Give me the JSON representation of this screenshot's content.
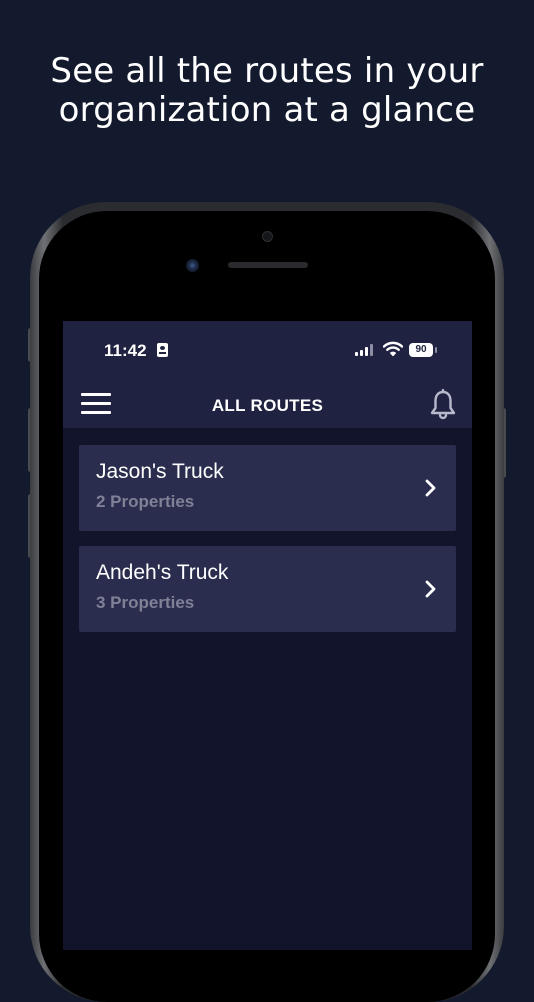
{
  "headline": {
    "line1": "See all the routes in your",
    "line2": "organization at a glance"
  },
  "status_bar": {
    "time": "11:42",
    "battery": "90",
    "icons": [
      "id-card-icon",
      "cellular-signal-icon",
      "wifi-icon",
      "battery-icon"
    ]
  },
  "nav": {
    "title": "ALL ROUTES",
    "left_icon": "hamburger-menu-icon",
    "right_icon": "bell-icon"
  },
  "routes": [
    {
      "name": "Jason's Truck",
      "subtitle": "2 Properties",
      "icon": "chevron-right-icon"
    },
    {
      "name": "Andeh's Truck",
      "subtitle": "3 Properties",
      "icon": "chevron-right-icon"
    }
  ],
  "colors": {
    "background": "#141a2e",
    "screen": "#11142a",
    "topbar": "#1f2240",
    "card": "#2a2d4d",
    "subtitle": "#7f8197",
    "text": "#ffffff"
  }
}
